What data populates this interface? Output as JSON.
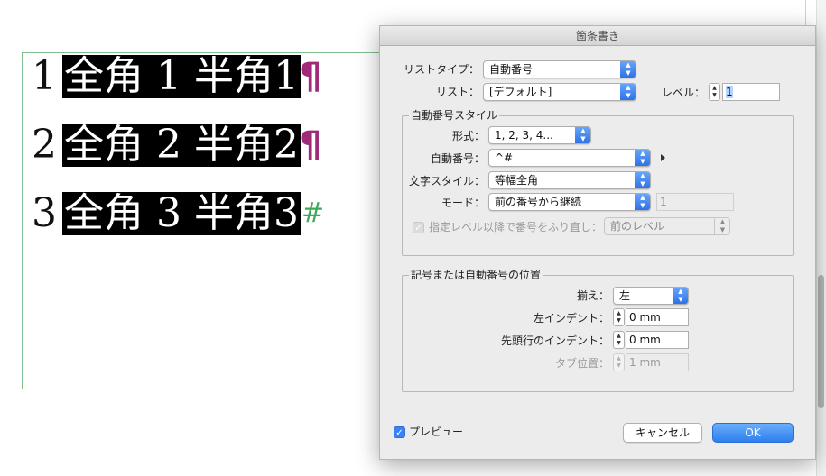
{
  "document": {
    "lines": [
      {
        "num": "1",
        "text": "全角 1 半角1",
        "mark": "¶"
      },
      {
        "num": "2",
        "text": "全角 2 半角2",
        "mark": "¶"
      },
      {
        "num": "3",
        "text": "全角 3 半角3",
        "mark": "#"
      }
    ]
  },
  "dialog": {
    "title": "箇条書き",
    "list_type_label": "リストタイプ：",
    "list_type_value": "自動番号",
    "list_label": "リスト：",
    "list_value": "[デフォルト]",
    "level_label": "レベル：",
    "level_value": "1",
    "numbering_style": {
      "title": "自動番号スタイル",
      "format_label": "形式：",
      "format_value": "1, 2, 3, 4...",
      "number_label": "自動番号：",
      "number_value": "^#",
      "char_style_label": "文字スタイル：",
      "char_style_value": "等幅全角",
      "mode_label": "モード：",
      "mode_value": "前の番号から継続",
      "mode_start_value": "1",
      "restart_label": "指定レベル以降で番号をふり直し：",
      "restart_value": "前のレベル"
    },
    "position": {
      "title": "記号または自動番号の位置",
      "align_label": "揃え：",
      "align_value": "左",
      "left_indent_label": "左インデント：",
      "left_indent_value": "0 mm",
      "first_indent_label": "先頭行のインデント：",
      "first_indent_value": "0 mm",
      "tab_label": "タブ位置：",
      "tab_value": "1 mm"
    },
    "preview_label": "プレビュー",
    "cancel_label": "キャンセル",
    "ok_label": "OK"
  },
  "colors": {
    "accent": "#2d7ff0",
    "pilcrow": "#a02a78",
    "end_mark": "#3daa5a",
    "frame": "#7fbf8f"
  }
}
